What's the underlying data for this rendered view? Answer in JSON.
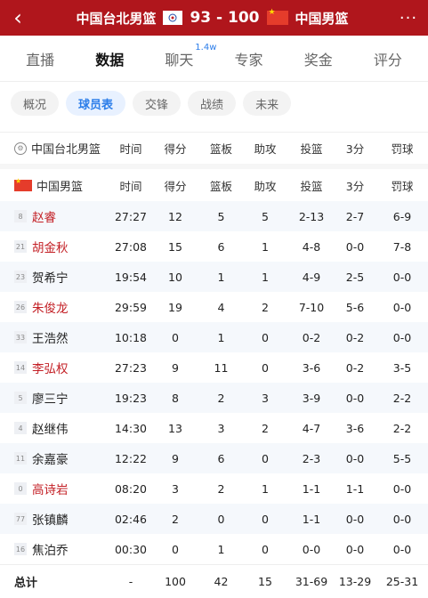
{
  "topbar": {
    "back_icon": "‹",
    "home_team": "中国台北男篮",
    "score": "93 - 100",
    "away_team": "中国男篮",
    "more_icon": "···"
  },
  "mainnav": [
    {
      "label": "直播",
      "active": false
    },
    {
      "label": "数据",
      "active": true
    },
    {
      "label": "聊天",
      "active": false,
      "sup": "1.4w"
    },
    {
      "label": "专家",
      "active": false
    },
    {
      "label": "奖金",
      "active": false
    },
    {
      "label": "评分",
      "active": false
    }
  ],
  "subnav": [
    "概况",
    "球员表",
    "交锋",
    "战绩",
    "未来"
  ],
  "subnav_active": 1,
  "table": {
    "home_header": {
      "team": "中国台北男篮",
      "cols": [
        "时间",
        "得分",
        "篮板",
        "助攻",
        "投篮",
        "3分",
        "罚球"
      ]
    },
    "away_header": {
      "team": "中国男篮",
      "cols": [
        "时间",
        "得分",
        "篮板",
        "助攻",
        "投篮",
        "3分",
        "罚球"
      ]
    },
    "players": [
      {
        "num": "8",
        "name": "赵睿",
        "starter": true,
        "time": "27:27",
        "pts": "12",
        "reb": "5",
        "ast": "5",
        "fg": "2-13",
        "three": "2-7",
        "ft": "6-9"
      },
      {
        "num": "21",
        "name": "胡金秋",
        "starter": true,
        "time": "27:08",
        "pts": "15",
        "reb": "6",
        "ast": "1",
        "fg": "4-8",
        "three": "0-0",
        "ft": "7-8"
      },
      {
        "num": "23",
        "name": "贺希宁",
        "starter": false,
        "time": "19:54",
        "pts": "10",
        "reb": "1",
        "ast": "1",
        "fg": "4-9",
        "three": "2-5",
        "ft": "0-0"
      },
      {
        "num": "26",
        "name": "朱俊龙",
        "starter": true,
        "time": "29:59",
        "pts": "19",
        "reb": "4",
        "ast": "2",
        "fg": "7-10",
        "three": "5-6",
        "ft": "0-0"
      },
      {
        "num": "33",
        "name": "王浩然",
        "starter": false,
        "time": "10:18",
        "pts": "0",
        "reb": "1",
        "ast": "0",
        "fg": "0-2",
        "three": "0-2",
        "ft": "0-0"
      },
      {
        "num": "14",
        "name": "李弘权",
        "starter": true,
        "time": "27:23",
        "pts": "9",
        "reb": "11",
        "ast": "0",
        "fg": "3-6",
        "three": "0-2",
        "ft": "3-5"
      },
      {
        "num": "5",
        "name": "廖三宁",
        "starter": false,
        "time": "19:23",
        "pts": "8",
        "reb": "2",
        "ast": "3",
        "fg": "3-9",
        "three": "0-0",
        "ft": "2-2"
      },
      {
        "num": "4",
        "name": "赵继伟",
        "starter": false,
        "time": "14:30",
        "pts": "13",
        "reb": "3",
        "ast": "2",
        "fg": "4-7",
        "three": "3-6",
        "ft": "2-2"
      },
      {
        "num": "11",
        "name": "余嘉豪",
        "starter": false,
        "time": "12:22",
        "pts": "9",
        "reb": "6",
        "ast": "0",
        "fg": "2-3",
        "three": "0-0",
        "ft": "5-5"
      },
      {
        "num": "0",
        "name": "高诗岩",
        "starter": true,
        "time": "08:20",
        "pts": "3",
        "reb": "2",
        "ast": "1",
        "fg": "1-1",
        "three": "1-1",
        "ft": "0-0"
      },
      {
        "num": "77",
        "name": "张镇麟",
        "starter": false,
        "time": "02:46",
        "pts": "2",
        "reb": "0",
        "ast": "0",
        "fg": "1-1",
        "three": "0-0",
        "ft": "0-0"
      },
      {
        "num": "16",
        "name": "焦泊乔",
        "starter": false,
        "time": "00:30",
        "pts": "0",
        "reb": "1",
        "ast": "0",
        "fg": "0-0",
        "three": "0-0",
        "ft": "0-0"
      }
    ],
    "total": {
      "label": "总计",
      "time": "-",
      "pts": "100",
      "reb": "42",
      "ast": "15",
      "fg": "31-69",
      "three": "13-29",
      "ft": "25-31"
    }
  }
}
